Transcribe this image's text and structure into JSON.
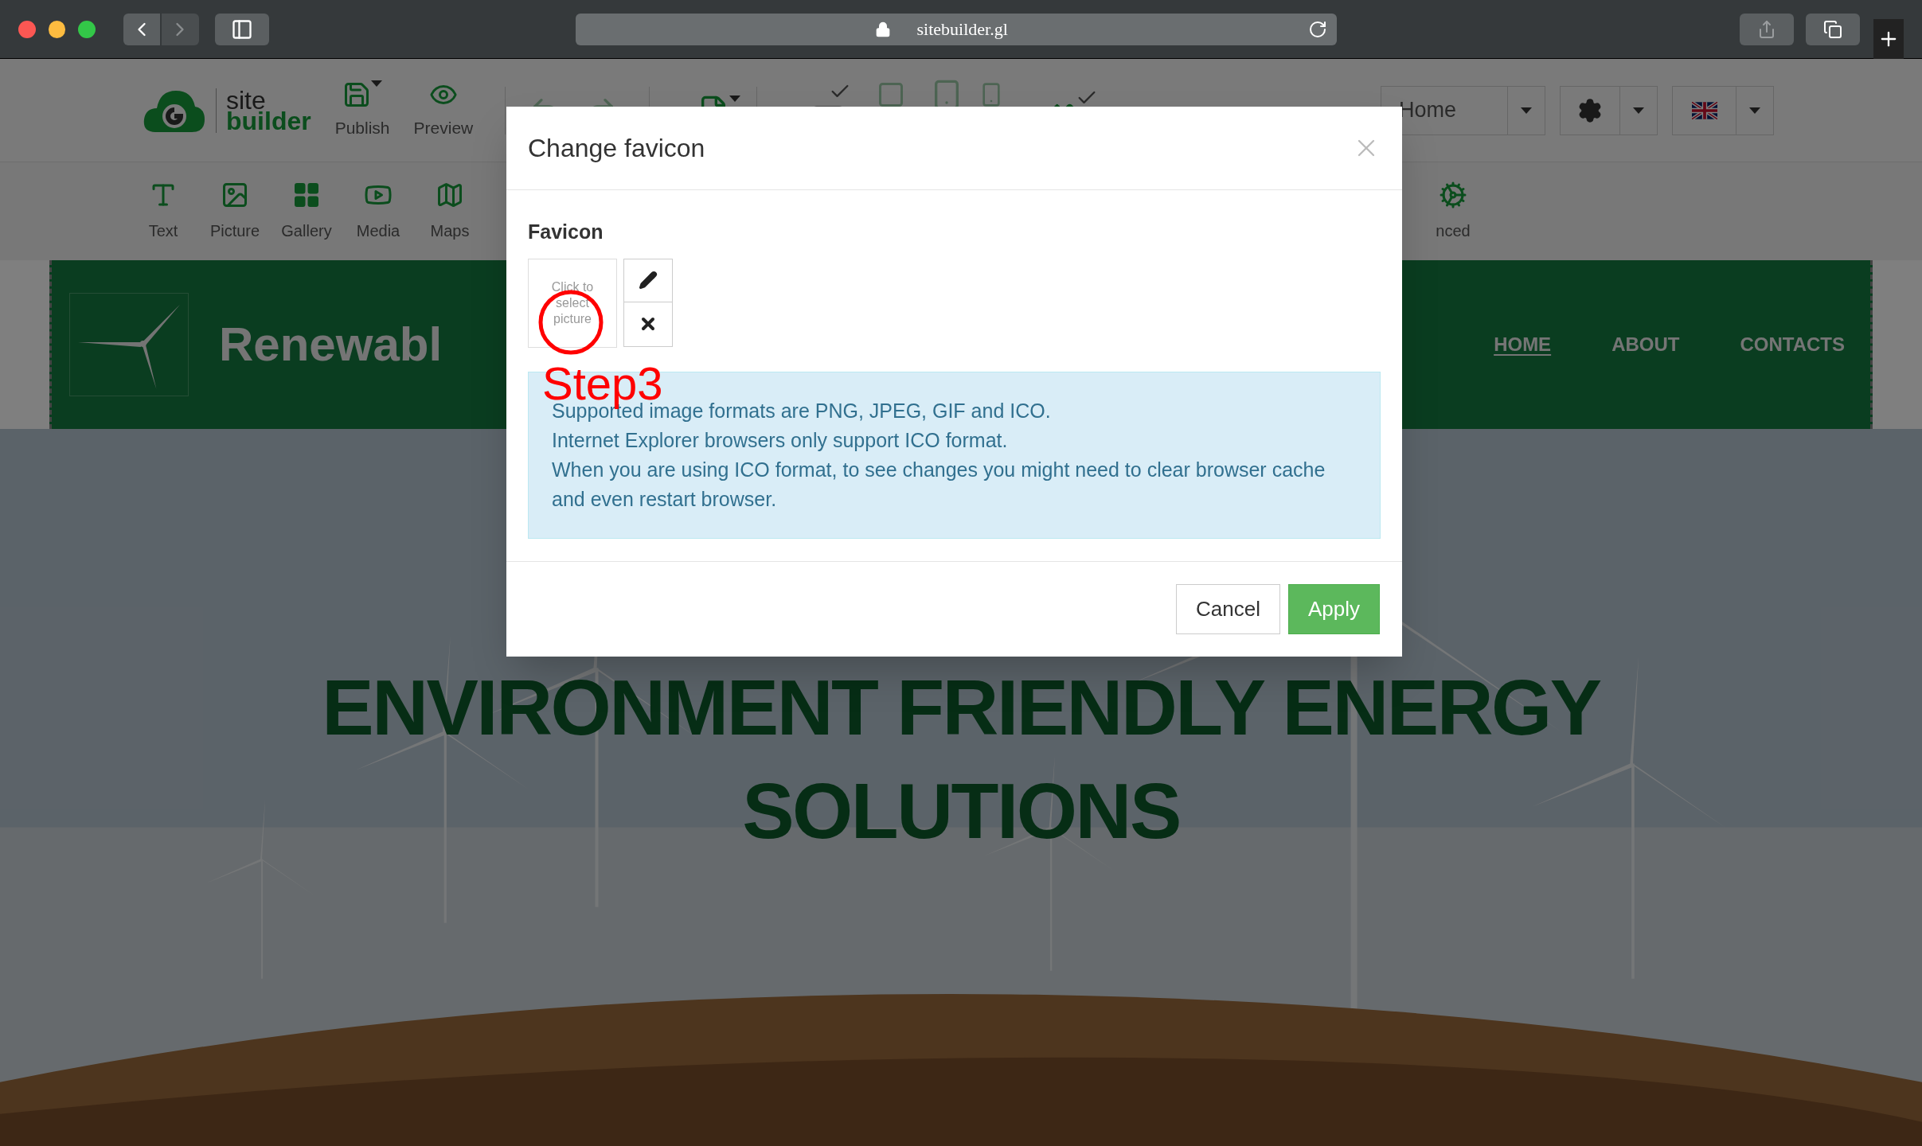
{
  "browser": {
    "url": "sitebuilder.gl"
  },
  "toolbar": {
    "logo": [
      "site",
      "builder"
    ],
    "actions": [
      {
        "label": "Publish",
        "kind": "save"
      },
      {
        "label": "Preview",
        "kind": "view"
      }
    ],
    "page_select": "Home"
  },
  "insert_tools": [
    {
      "label": "Text",
      "kind": "text"
    },
    {
      "label": "Picture",
      "kind": "picture"
    },
    {
      "label": "Gallery",
      "kind": "gallery"
    },
    {
      "label": "Media",
      "kind": "media"
    },
    {
      "label": "Maps",
      "kind": "maps"
    },
    {
      "label": "nced",
      "kind": "advanced"
    }
  ],
  "site": {
    "brand": "Renewabl",
    "nav": [
      {
        "label": "HOME",
        "selected": true
      },
      {
        "label": "ABOUT",
        "selected": false
      },
      {
        "label": "CONTACTS",
        "selected": false
      }
    ],
    "hero": {
      "heading": [
        "ENVIRONMENT FRIENDLY ENERGY",
        "SOLUTIONS"
      ]
    }
  },
  "dialog": {
    "title": "Change favicon",
    "section_label": "Favicon",
    "picker_text": "Click to select picture",
    "annotation": "Step3",
    "info": [
      "Supported image formats are PNG, JPEG, GIF and ICO.",
      "Internet Explorer browsers only support ICO format.",
      "When you are using ICO format, to see changes you might need to clear browser cache and even restart browser."
    ],
    "buttons": [
      {
        "label": "Cancel",
        "kind": "default"
      },
      {
        "label": "Apply",
        "kind": "primary"
      }
    ]
  }
}
